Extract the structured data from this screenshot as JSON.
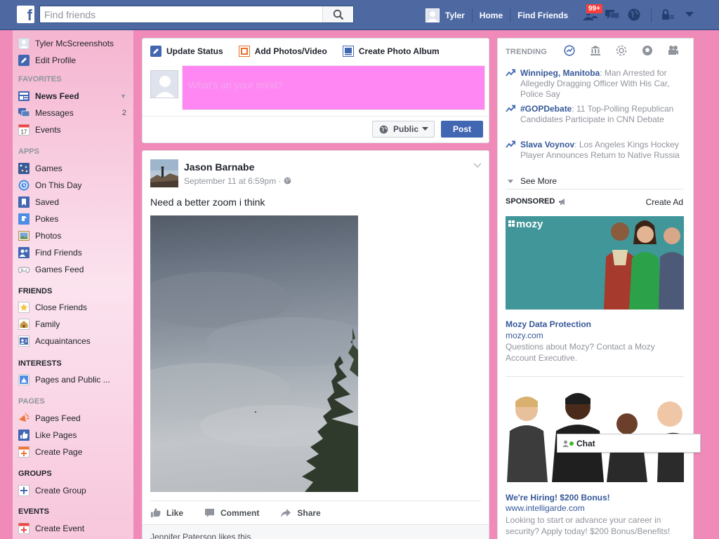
{
  "topbar": {
    "logo_letter": "f",
    "search_placeholder": "Find friends",
    "user_name": "Tyler",
    "links": [
      "Home",
      "Find Friends"
    ],
    "friend_requests_badge": "99+",
    "brand_color": "#4e69a2"
  },
  "leftnav": {
    "profile_name": "Tyler McScreenshots",
    "edit_profile": "Edit Profile",
    "sections": {
      "favorites": "FAVORITES",
      "apps": "APPS",
      "friends": "FRIENDS",
      "interests": "INTERESTS",
      "pages": "PAGES",
      "groups": "GROUPS",
      "events": "EVENTS"
    },
    "favorites": [
      {
        "label": "News Feed",
        "icon": "news-feed-icon"
      },
      {
        "label": "Messages",
        "icon": "messages-icon",
        "count": "2"
      },
      {
        "label": "Events",
        "icon": "calendar-icon",
        "icon_text": "17"
      }
    ],
    "apps": [
      {
        "label": "Games",
        "icon": "games-icon"
      },
      {
        "label": "On This Day",
        "icon": "on-this-day-icon"
      },
      {
        "label": "Saved",
        "icon": "saved-icon"
      },
      {
        "label": "Pokes",
        "icon": "pokes-icon"
      },
      {
        "label": "Photos",
        "icon": "photos-icon"
      },
      {
        "label": "Find Friends",
        "icon": "find-friends-icon"
      },
      {
        "label": "Games Feed",
        "icon": "games-feed-icon"
      }
    ],
    "friends": [
      {
        "label": "Close Friends",
        "icon": "star-icon"
      },
      {
        "label": "Family",
        "icon": "house-icon"
      },
      {
        "label": "Acquaintances",
        "icon": "acquaintances-icon"
      }
    ],
    "interests": [
      {
        "label": "Pages and Public ...",
        "icon": "pages-public-icon"
      }
    ],
    "pages": [
      {
        "label": "Pages Feed",
        "icon": "pages-feed-icon"
      },
      {
        "label": "Like Pages",
        "icon": "thumbs-up-icon"
      },
      {
        "label": "Create Page",
        "icon": "create-page-icon"
      }
    ],
    "groups": [
      {
        "label": "Create Group",
        "icon": "create-group-icon"
      }
    ],
    "events": [
      {
        "label": "Create Event",
        "icon": "create-event-icon"
      }
    ],
    "background_color": "#f08ab8"
  },
  "composer": {
    "tabs": [
      "Update Status",
      "Add Photos/Video",
      "Create Photo Album"
    ],
    "placeholder": "What's on your mind?",
    "privacy": "Public",
    "post_button": "Post",
    "input_color": "#ff87f3"
  },
  "story": {
    "author": "Jason Barnabe",
    "timestamp": "September 11 at 6:59pm",
    "text": "Need a better zoom i think",
    "actions": [
      "Like",
      "Comment",
      "Share"
    ],
    "likes_text": "Jennifer Paterson likes this."
  },
  "trending": {
    "title": "TRENDING",
    "items": [
      {
        "topic": "Winnipeg, Manitoba",
        "text": ": Man Arrested for Allegedly Dragging Officer With His Car, Police Say"
      },
      {
        "topic": "#GOPDebate",
        "text": ": 11 Top-Polling Republican Candidates Participate in CNN Debate"
      },
      {
        "topic": "Slava Voynov",
        "text": ": Los Angeles Kings Hockey Player Announces Return to Native Russia"
      }
    ],
    "see_more": "See More"
  },
  "sponsored": {
    "title": "SPONSORED",
    "create_ad": "Create Ad",
    "ads": [
      {
        "logo": "mozy",
        "title": "Mozy Data Protection",
        "url": "mozy.com",
        "desc": "Questions about Mozy? Contact a Mozy Account Executive."
      },
      {
        "title": "We're Hiring! $200 Bonus!",
        "url": "www.intelligarde.com",
        "desc": "Looking to start or advance your career in security? Apply today! $200 Bonus/Benefits!"
      }
    ]
  },
  "chat": {
    "label": "Chat"
  }
}
